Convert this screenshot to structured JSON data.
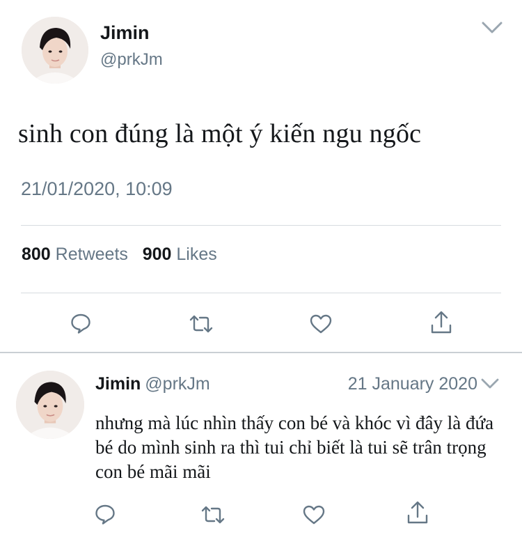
{
  "main_tweet": {
    "name": "Jimin",
    "handle": "@prkJm",
    "text": "sinh con đúng là một ý kiến ngu ngốc",
    "timestamp": "21/01/2020, 10:09",
    "retweet_count": "800",
    "retweet_label": "Retweets",
    "like_count": "900",
    "like_label": "Likes"
  },
  "reply_tweet": {
    "name": "Jimin",
    "handle": "@prkJm",
    "date": "21 January 2020",
    "text": "nhưng mà lúc nhìn thấy con bé và khóc vì đây là đứa bé do mình sinh ra thì tui chỉ biết là tui sẽ trân trọng con bé mãi mãi"
  },
  "icons": {
    "reply": "comment-icon",
    "retweet": "retweet-icon",
    "like": "heart-icon",
    "share": "share-icon",
    "menu": "chevron-down-icon"
  },
  "colors": {
    "text": "#14171a",
    "secondary": "#657786",
    "icon": "#657786",
    "divider": "#d6dbdf"
  }
}
